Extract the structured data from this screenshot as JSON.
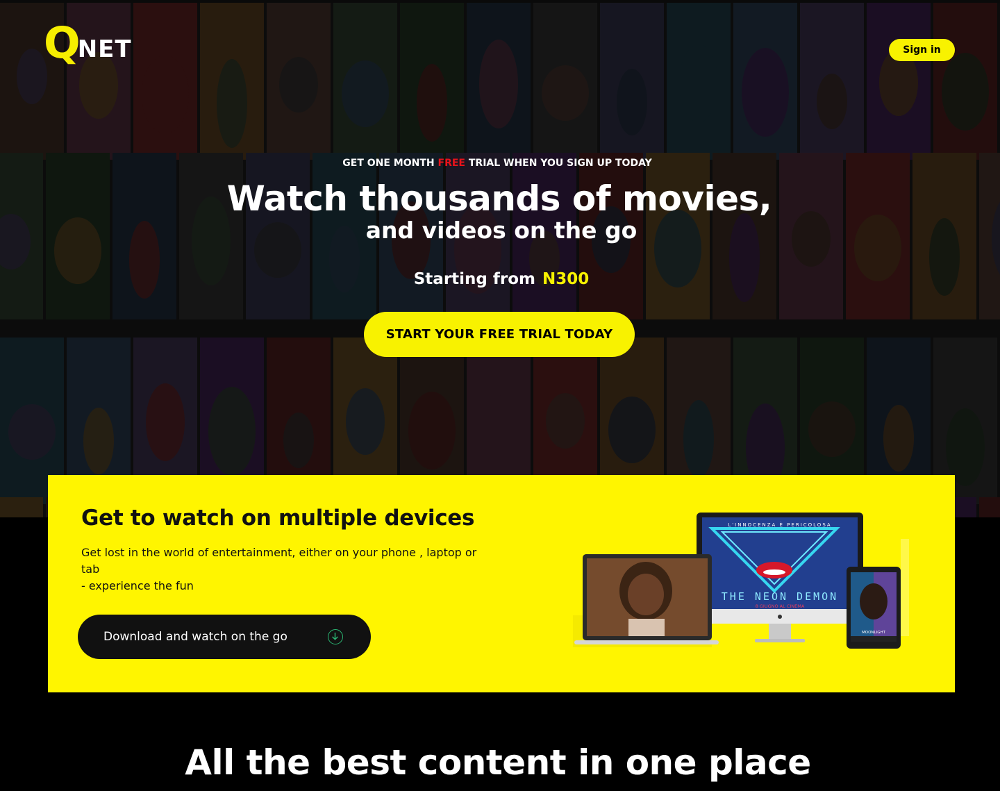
{
  "brand": {
    "logo_q": "Q",
    "logo_net": "NET",
    "accent": "#f8f200",
    "highlight": "#e8131b"
  },
  "header": {
    "signin_label": "Sign in"
  },
  "hero": {
    "eyebrow_before": "GET ONE MONTH ",
    "eyebrow_free": "FREE",
    "eyebrow_after": " TRIAL WHEN YOU SIGN UP TODAY",
    "headline": "Watch thousands of movies,",
    "subheadline": "and videos on the go",
    "price_prefix": "Starting from",
    "price": "N300",
    "cta_label": "START YOUR FREE TRIAL TODAY"
  },
  "devices_card": {
    "title": "Get to watch on multiple devices",
    "text_line1": "Get lost in the world of entertainment, either on your phone , laptop or tab",
    "text_line2": "- experience the fun",
    "button_label": "Download and watch on the go",
    "button_icon": "arrow-down-circle-icon",
    "imac_poster_top": "L'INNOCENZA È PERICOLOSA",
    "imac_poster_title": "THE NEON DEMON",
    "imac_poster_date": "8 GIUGNO AL CINEMA",
    "tablet_poster_title": "MOONLIGHT"
  },
  "content_section": {
    "heading": "All the best content in one place"
  }
}
